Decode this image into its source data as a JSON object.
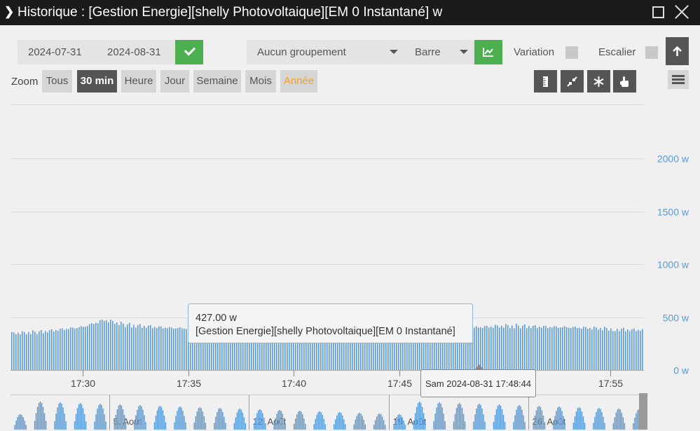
{
  "window": {
    "title": "Historique : [Gestion Energie][shelly Photovoltaique][EM 0 Instantané] w"
  },
  "toolbar": {
    "date_start": "2024-07-31",
    "date_end": "2024-08-31",
    "grouping": "Aucun groupement",
    "chart_type": "Barre",
    "variation_label": "Variation",
    "stair_label": "Escalier",
    "variation_checked": false,
    "stair_checked": false
  },
  "zoom": {
    "label": "Zoom",
    "buttons": [
      "Tous",
      "30 min",
      "Heure",
      "Jour",
      "Semaine",
      "Mois",
      "Année"
    ],
    "active": "30 min"
  },
  "icons": {
    "ok": "check-icon",
    "chart": "line-chart-icon",
    "up": "arrow-up-icon",
    "tools": [
      "ruler-icon",
      "compress-icon",
      "snowflake-icon",
      "hand-pointer-icon"
    ],
    "menu": "hamburger-icon"
  },
  "colors": {
    "bar": "#5b9bd5",
    "accent_green": "#4caf50",
    "year_text": "#f0a030"
  },
  "tooltip": {
    "value": "427.00 w",
    "series": "[Gestion Energie][shelly Photovoltaique][EM 0 Instantané]",
    "x_label": "Sam 2024-08-31 17:48:44"
  },
  "chart_data": {
    "type": "bar",
    "series": [
      {
        "name": "[Gestion Energie][shelly Photovoltaique][EM 0 Instantané]"
      }
    ],
    "y_ticks": [
      "0 w",
      "500 w",
      "1000 w",
      "1500 w",
      "2000 w"
    ],
    "ylim": [
      0,
      2500
    ],
    "x_ticks": [
      "17:30",
      "17:35",
      "17:40",
      "17:45",
      "17:55"
    ],
    "x_values_sample": [
      {
        "x": "17:26",
        "y": 360
      },
      {
        "x": "17:28",
        "y": 380
      },
      {
        "x": "17:30",
        "y": 430
      },
      {
        "x": "17:31",
        "y": 500
      },
      {
        "x": "17:32",
        "y": 450
      },
      {
        "x": "17:34",
        "y": 420
      },
      {
        "x": "17:36",
        "y": 410
      },
      {
        "x": "17:38",
        "y": 400
      },
      {
        "x": "17:42",
        "y": 410
      },
      {
        "x": "17:45",
        "y": 380
      },
      {
        "x": "17:48:44",
        "y": 427
      },
      {
        "x": "17:50",
        "y": 440
      },
      {
        "x": "17:52",
        "y": 430
      },
      {
        "x": "17:54",
        "y": 420
      },
      {
        "x": "17:56",
        "y": 400
      }
    ],
    "navigator_labels": [
      "5. Août",
      "12. Août",
      "19. Août",
      "26. Août"
    ],
    "grid": true,
    "legend": "none"
  }
}
